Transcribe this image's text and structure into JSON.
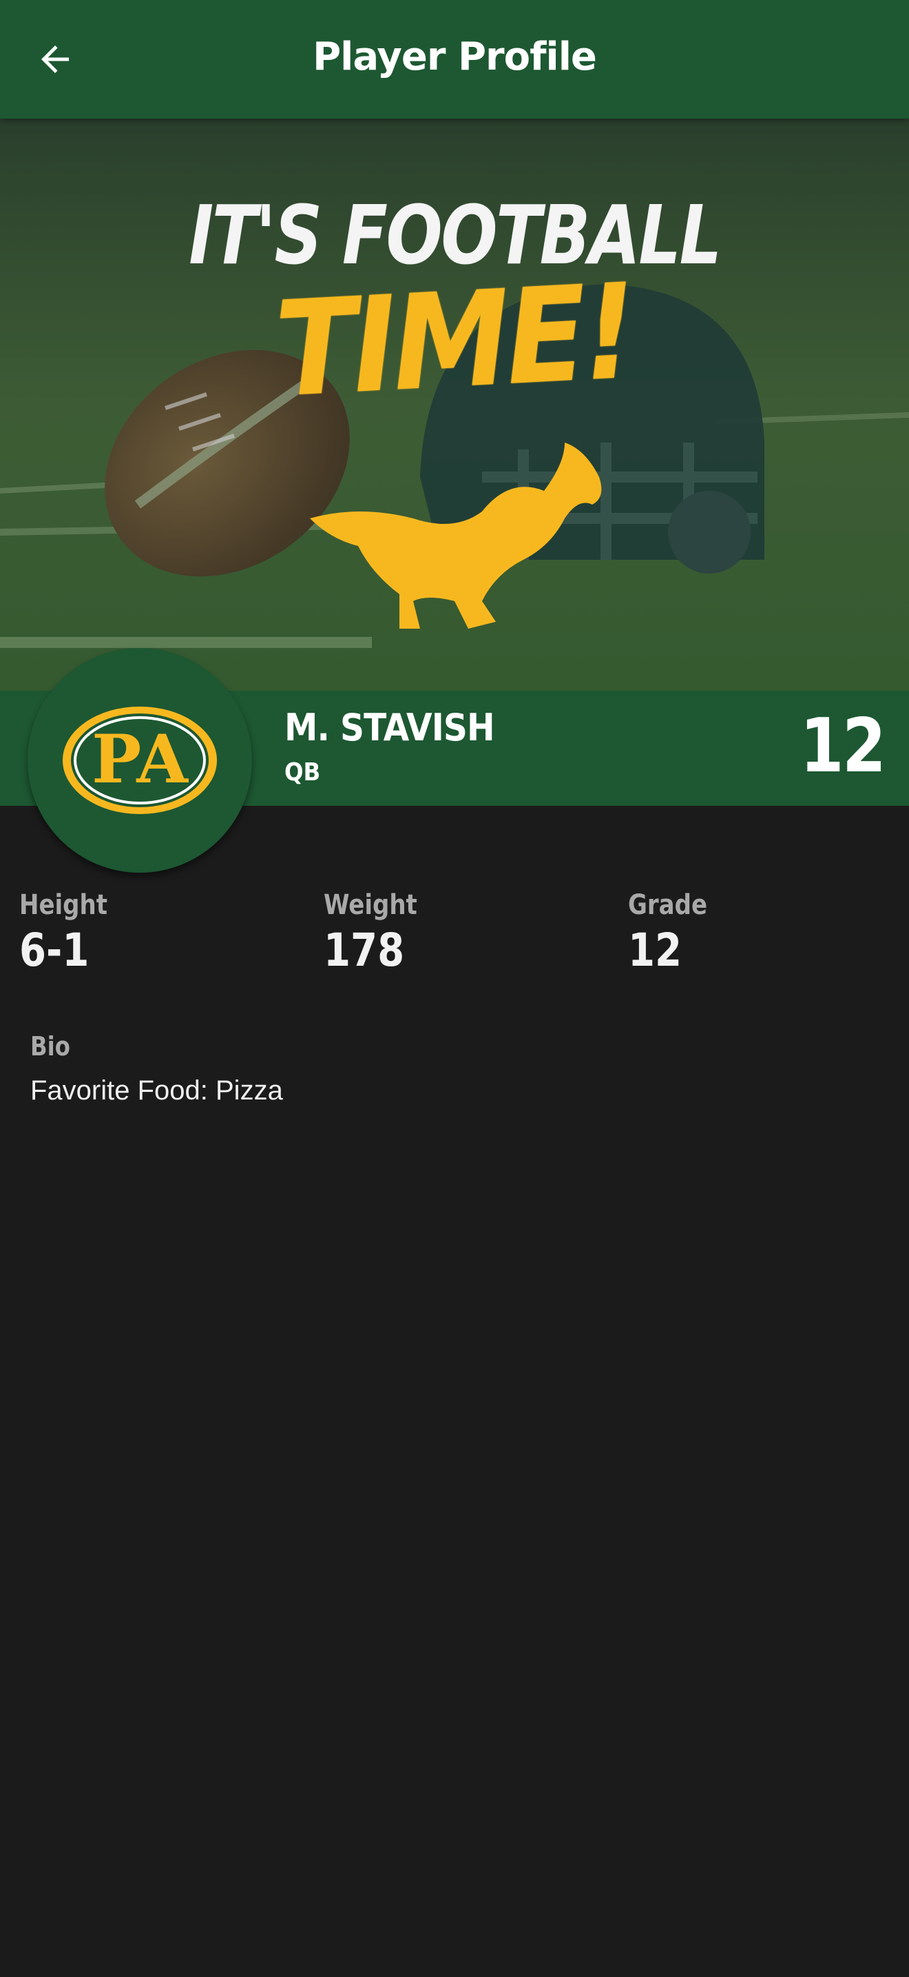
{
  "appbar": {
    "title": "Player Profile",
    "back_icon": "arrow-left-icon",
    "background_color": "#1d5832"
  },
  "hero": {
    "line1": "IT'S FOOTBALL",
    "line2": "TIME!",
    "accent_color": "#f7b81f",
    "mascot_icon": "mustang-icon"
  },
  "player": {
    "logo_text": "PA",
    "name": "M. STAVISH",
    "position": "QB",
    "number": "12"
  },
  "stats": [
    {
      "label": "Height",
      "value": "6-1"
    },
    {
      "label": "Weight",
      "value": "178"
    },
    {
      "label": "Grade",
      "value": "12"
    }
  ],
  "bio": {
    "label": "Bio",
    "text": "Favorite Food: Pizza"
  }
}
